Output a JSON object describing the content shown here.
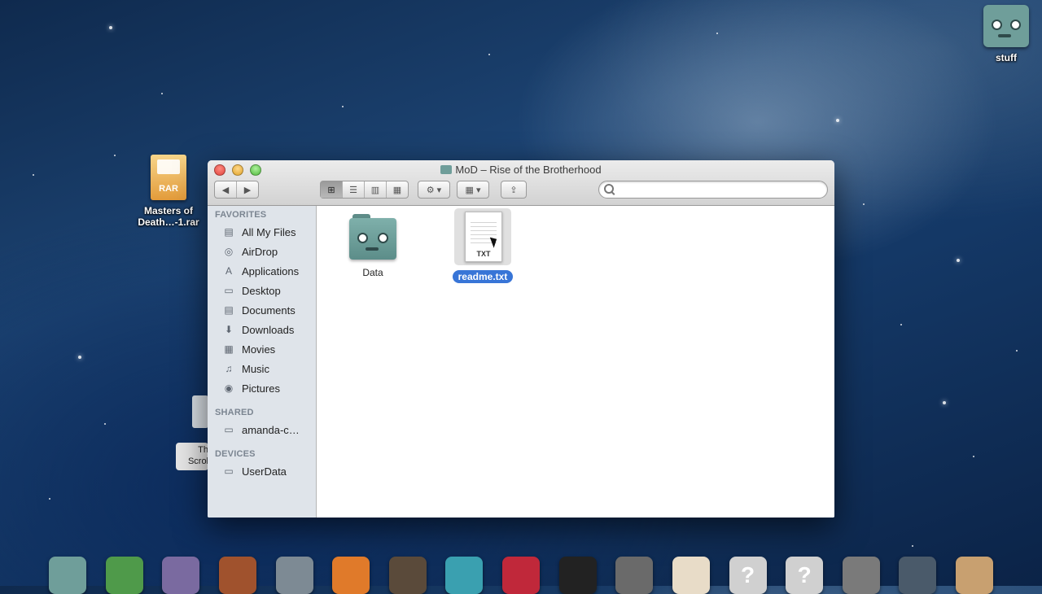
{
  "desktop": {
    "rar_file": {
      "label": "Masters of Death…-1.rar",
      "badge": "RAR"
    },
    "stuff_folder": {
      "label": "stuff"
    },
    "background_window_label": "Th Scrol"
  },
  "window": {
    "title": "MoD – Rise of the Brotherhood",
    "search": {
      "value": "",
      "placeholder": ""
    },
    "toolbar": {
      "back": "◀",
      "forward": "▶",
      "view_icon": "⊞",
      "view_list": "☰",
      "view_columns": "▥",
      "view_coverflow": "▦",
      "action": "⚙ ▾",
      "arrange": "▦ ▾",
      "share": "⇪"
    },
    "sidebar": {
      "favorites_header": "FAVORITES",
      "favorites": [
        {
          "label": "All My Files",
          "icon": "all-files-icon",
          "glyph": "▤"
        },
        {
          "label": "AirDrop",
          "icon": "airdrop-icon",
          "glyph": "◎"
        },
        {
          "label": "Applications",
          "icon": "applications-icon",
          "glyph": "A"
        },
        {
          "label": "Desktop",
          "icon": "desktop-icon",
          "glyph": "▭"
        },
        {
          "label": "Documents",
          "icon": "documents-icon",
          "glyph": "▤"
        },
        {
          "label": "Downloads",
          "icon": "downloads-icon",
          "glyph": "⬇"
        },
        {
          "label": "Movies",
          "icon": "movies-icon",
          "glyph": "▦"
        },
        {
          "label": "Music",
          "icon": "music-icon",
          "glyph": "♫"
        },
        {
          "label": "Pictures",
          "icon": "pictures-icon",
          "glyph": "◉"
        }
      ],
      "shared_header": "SHARED",
      "shared": [
        {
          "label": "amanda-c…",
          "icon": "shared-computer-icon",
          "glyph": "▭"
        }
      ],
      "devices_header": "DEVICES",
      "devices": [
        {
          "label": "UserData",
          "icon": "drive-icon",
          "glyph": "▭"
        }
      ]
    },
    "files": [
      {
        "name": "Data",
        "type": "folder",
        "selected": false
      },
      {
        "name": "readme.txt",
        "type": "txt",
        "ext": "TXT",
        "selected": true
      }
    ]
  },
  "colors": {
    "selection": "#3875d7",
    "sidebar_bg": "#dfe4ea"
  },
  "dock": {
    "items": [
      {
        "icon": "finder-icon",
        "color": "#6f9e9a",
        "glyph": ""
      },
      {
        "icon": "books-icon",
        "color": "#4f9a4a",
        "glyph": ""
      },
      {
        "icon": "potion-icon",
        "color": "#7a6aa0",
        "glyph": ""
      },
      {
        "icon": "toolbox-icon",
        "color": "#a0522d",
        "glyph": ""
      },
      {
        "icon": "stopwatch-icon",
        "color": "#7d8a94",
        "glyph": ""
      },
      {
        "icon": "firefox-icon",
        "color": "#e07a2a",
        "glyph": ""
      },
      {
        "icon": "guitar-icon",
        "color": "#5a4a3a",
        "glyph": ""
      },
      {
        "icon": "speedometer-icon",
        "color": "#3aa0b0",
        "glyph": ""
      },
      {
        "icon": "photobooth-icon",
        "color": "#c0283a",
        "glyph": ""
      },
      {
        "icon": "clapper-icon",
        "color": "#222222",
        "glyph": ""
      },
      {
        "icon": "headphones-icon",
        "color": "#6a6a6a",
        "glyph": ""
      },
      {
        "icon": "gift-icon",
        "color": "#e8dcc8",
        "glyph": ""
      },
      {
        "icon": "question-icon",
        "color": "#d0d0d0",
        "glyph": "?"
      },
      {
        "icon": "question-icon",
        "color": "#d0d0d0",
        "glyph": "?"
      },
      {
        "icon": "itunes-icon",
        "color": "#7a7a7a",
        "glyph": ""
      },
      {
        "icon": "monitor-icon",
        "color": "#4a5a6a",
        "glyph": ""
      },
      {
        "icon": "box-icon",
        "color": "#c8a070",
        "glyph": ""
      }
    ]
  }
}
